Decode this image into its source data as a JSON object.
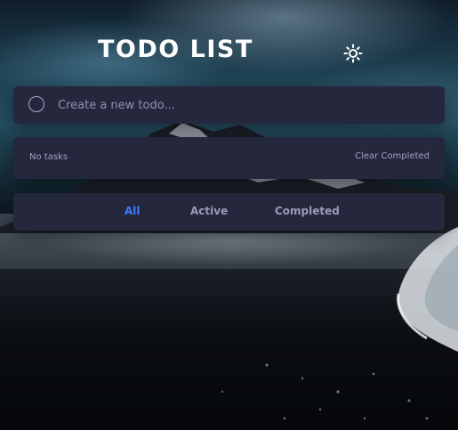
{
  "header": {
    "title": "TODO LIST",
    "theme_icon": "sun-icon"
  },
  "create": {
    "placeholder": "Create a new todo...",
    "value": "",
    "check_icon": "circle-icon"
  },
  "status": {
    "count_text": "No tasks",
    "clear_label": "Clear Completed"
  },
  "filters": {
    "items": [
      {
        "label": "All",
        "active": true
      },
      {
        "label": "Active",
        "active": false
      },
      {
        "label": "Completed",
        "active": false
      }
    ]
  },
  "colors": {
    "card_bg": "#25273d",
    "accent": "#3a7bfd",
    "muted_text": "#a0a3bd",
    "title_text": "#ffffff"
  }
}
